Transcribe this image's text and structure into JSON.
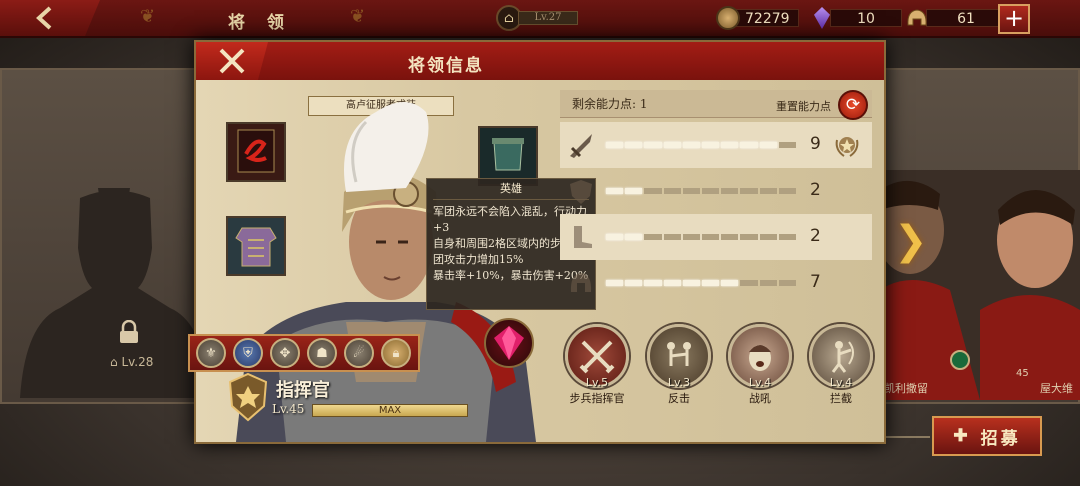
{
  "topbar": {
    "title": "将 领",
    "level": "Lv.27",
    "coins": "72279",
    "gems": "10",
    "helmets": "61"
  },
  "modal": {
    "title": "将领信息",
    "outfit_label": "高卢征服者戎装"
  },
  "tooltip": {
    "title": "英雄",
    "lines": [
      "军团永远不会陷入混乱，行动力",
      "+3",
      "自身和周围2格区域内的步兵军",
      "团攻击力增加15%",
      "暴击率+10%，暴击伤害+20%"
    ]
  },
  "hero": {
    "title": "指挥官",
    "level": "Lv.45",
    "level_bar": "MAX"
  },
  "stats": {
    "remaining_label": "剩余能力点: 1",
    "reset_label": "重置能力点",
    "rows": [
      {
        "value": "9",
        "filled": 9
      },
      {
        "value": "2",
        "filled": 2
      },
      {
        "value": "2",
        "filled": 2
      },
      {
        "value": "7",
        "filled": 7
      }
    ],
    "segments": 10
  },
  "skills": [
    {
      "level": "Lv.5",
      "name": "步兵指挥官"
    },
    {
      "level": "Lv.3",
      "name": "反击"
    },
    {
      "level": "Lv.4",
      "name": "战吼"
    },
    {
      "level": "Lv.4",
      "name": "拦截"
    }
  ],
  "left_locked": {
    "level": "Lv.28"
  },
  "right_heroes": {
    "name1": "凯利撒留",
    "name2": "屋大维",
    "num": "45"
  },
  "recruit": {
    "label": "招募"
  },
  "colors": {
    "accent_red": "#a31d15",
    "gold": "#f0c04a",
    "parchment": "#d9c9a4"
  }
}
